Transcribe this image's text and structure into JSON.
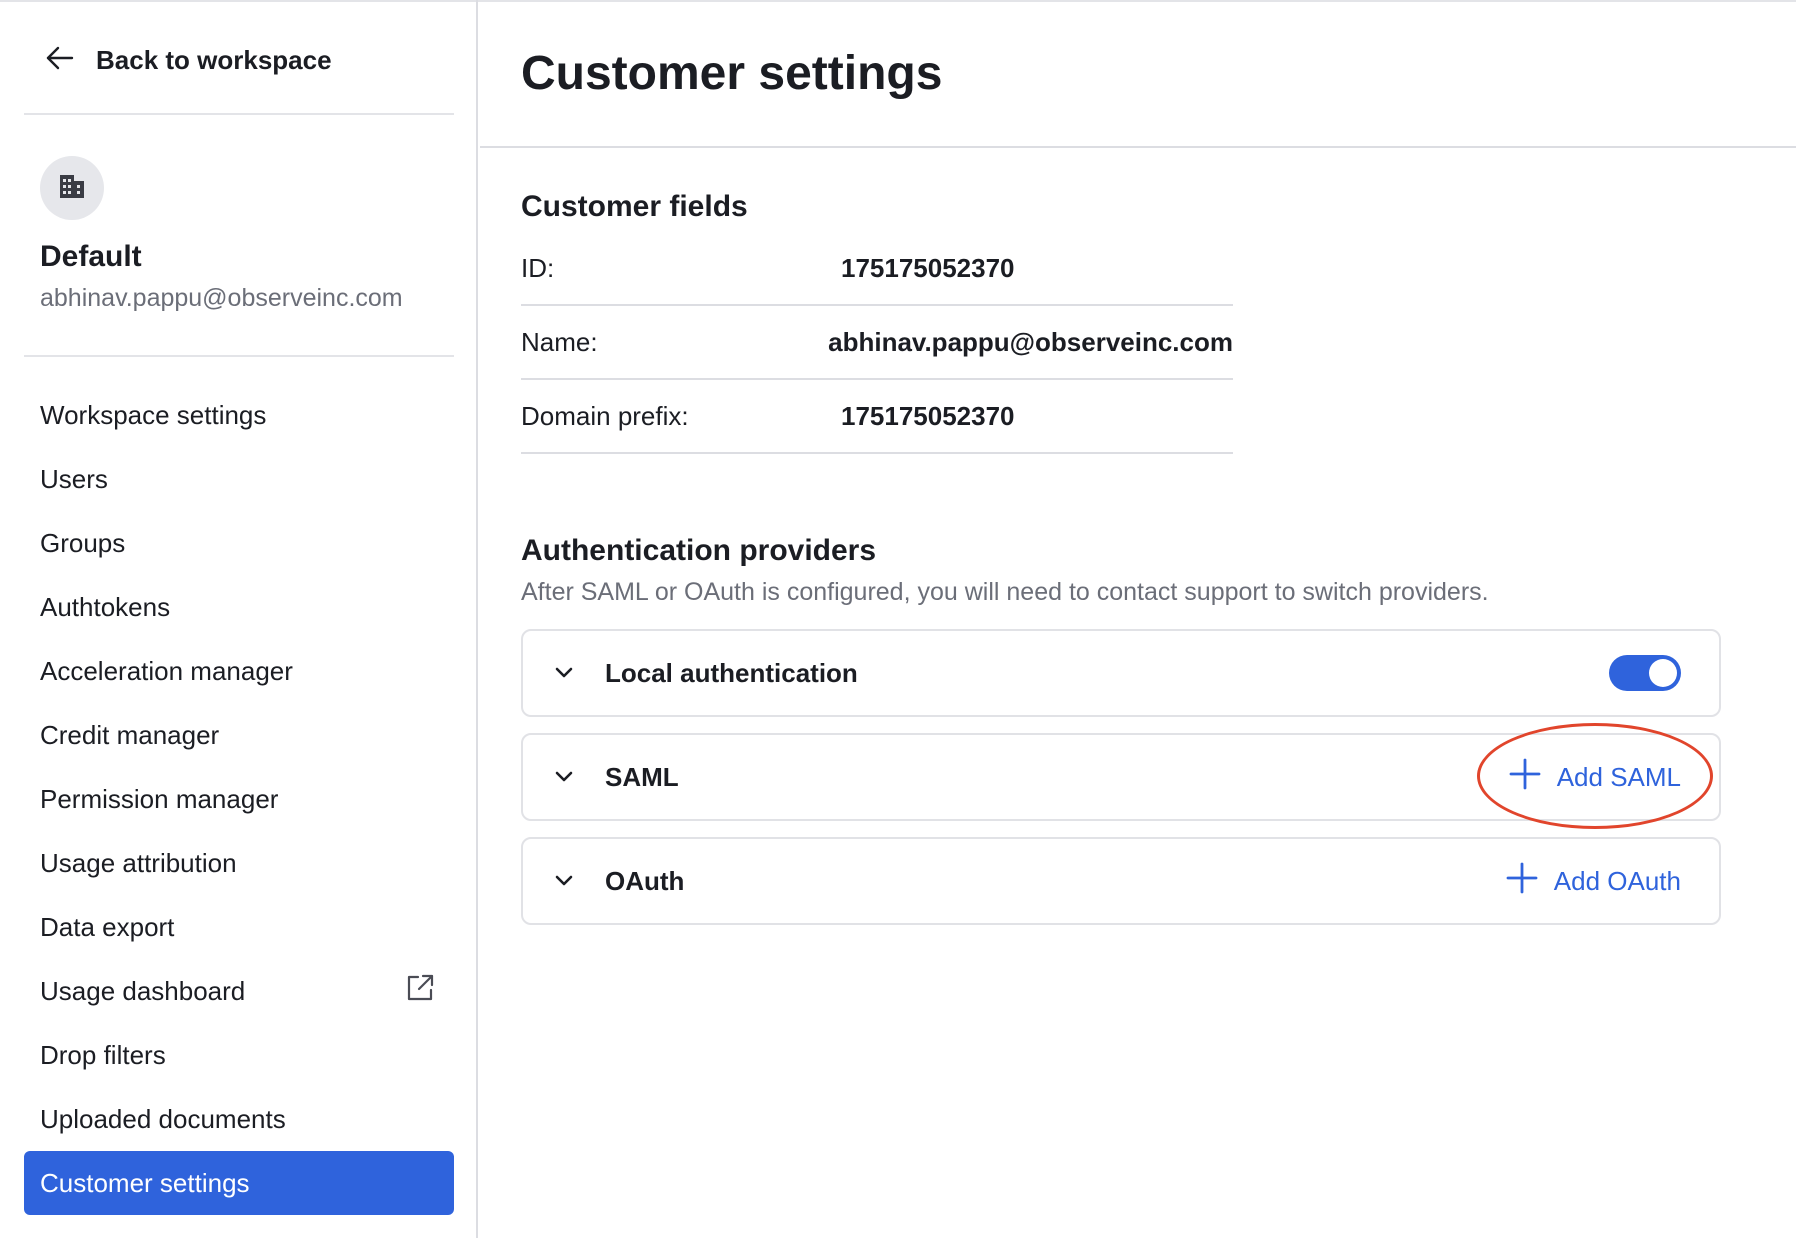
{
  "sidebar": {
    "back_label": "Back to workspace",
    "org_name": "Default",
    "org_email": "abhinav.pappu@observeinc.com",
    "items": [
      {
        "label": "Workspace settings"
      },
      {
        "label": "Users"
      },
      {
        "label": "Groups"
      },
      {
        "label": "Authtokens"
      },
      {
        "label": "Acceleration manager"
      },
      {
        "label": "Credit manager"
      },
      {
        "label": "Permission manager"
      },
      {
        "label": "Usage attribution"
      },
      {
        "label": "Data export"
      },
      {
        "label": "Usage dashboard",
        "icon": "external-link-icon"
      },
      {
        "label": "Drop filters"
      },
      {
        "label": "Uploaded documents"
      },
      {
        "label": "Customer settings",
        "active": true
      }
    ]
  },
  "main": {
    "title": "Customer settings",
    "customer_fields": {
      "title": "Customer fields",
      "rows": [
        {
          "label": "ID:",
          "value": "175175052370"
        },
        {
          "label": "Name:",
          "value": "abhinav.pappu@observeinc.com"
        },
        {
          "label": "Domain prefix:",
          "value": "175175052370"
        }
      ]
    },
    "auth": {
      "title": "Authentication providers",
      "subtitle": "After SAML or OAuth is configured, you will need to contact support to switch providers.",
      "providers": [
        {
          "name": "Local authentication",
          "toggle_on": true
        },
        {
          "name": "SAML",
          "action_label": "Add SAML"
        },
        {
          "name": "OAuth",
          "action_label": "Add OAuth"
        }
      ]
    }
  },
  "colors": {
    "accent": "#2f63dc",
    "annotation": "#e1452c"
  }
}
